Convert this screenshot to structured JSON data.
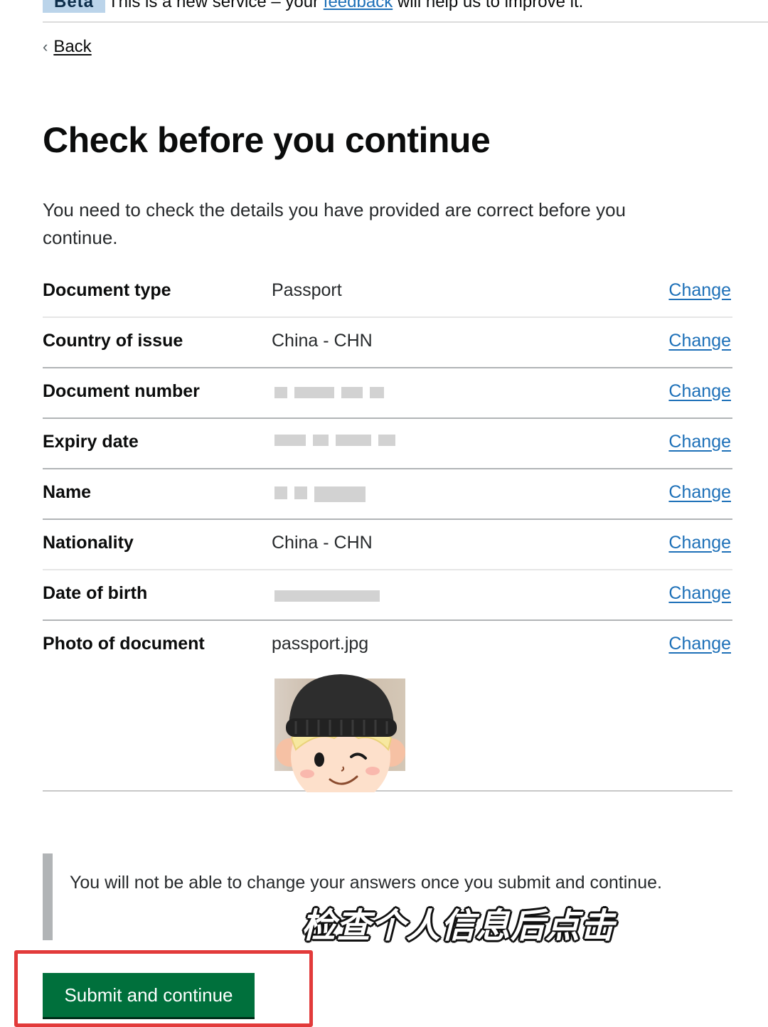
{
  "phase_banner": {
    "tag": "Beta",
    "text_before": "This is a new service – your ",
    "link": "feedback",
    "text_after": " will help us to improve it."
  },
  "back_link": "Back",
  "page_title": "Check before you continue",
  "lead": "You need to check the details you have provided are correct before you continue.",
  "summary": {
    "rows": [
      {
        "key": "Document type",
        "value": "Passport",
        "action": "Change"
      },
      {
        "key": "Country of issue",
        "value": "China - CHN",
        "action": "Change"
      },
      {
        "key": "Document number",
        "value": "",
        "action": "Change"
      },
      {
        "key": "Expiry date",
        "value": "",
        "action": "Change"
      },
      {
        "key": "Name",
        "value": "",
        "action": "Change"
      },
      {
        "key": "Nationality",
        "value": "China - CHN",
        "action": "Change"
      },
      {
        "key": "Date of birth",
        "value": "",
        "action": "Change"
      },
      {
        "key": "Photo of document",
        "value": "passport.jpg",
        "action": "Change"
      }
    ]
  },
  "warning_text": "You will not be able to change your answers once you submit and continue.",
  "overlay_caption": "检查个人信息后点击",
  "submit_button": "Submit and continue",
  "colors": {
    "button_green": "#00703c",
    "link_blue": "#1d70b8",
    "highlight_red": "#e23a3a",
    "phase_tag_bg": "#bbd4ea"
  }
}
